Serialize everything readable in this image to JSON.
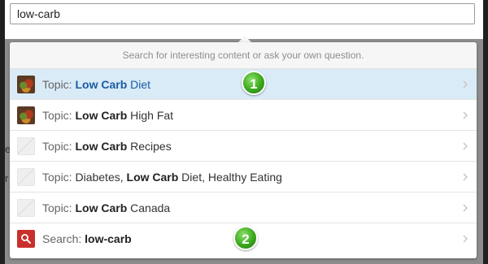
{
  "search": {
    "value": "low-carb"
  },
  "dropdown": {
    "hint": "Search for interesting content or ask your own question.",
    "items": [
      {
        "prefix": "Topic: ",
        "parts": [
          {
            "text": "Low Carb",
            "strong": true
          },
          {
            "text": " Diet",
            "strong": false
          }
        ],
        "thumb": "food-thumbnail",
        "selected": true
      },
      {
        "prefix": "Topic: ",
        "parts": [
          {
            "text": "Low Carb",
            "strong": true
          },
          {
            "text": " High Fat",
            "strong": false
          }
        ],
        "thumb": "food-thumbnail",
        "selected": false
      },
      {
        "prefix": "Topic: ",
        "parts": [
          {
            "text": "Low Carb",
            "strong": true
          },
          {
            "text": " Recipes",
            "strong": false
          }
        ],
        "thumb": "placeholder-thumbnail",
        "selected": false
      },
      {
        "prefix": "Topic: ",
        "parts": [
          {
            "text": "Diabetes, ",
            "strong": false
          },
          {
            "text": "Low Carb",
            "strong": true
          },
          {
            "text": " Diet, Healthy Eating",
            "strong": false
          }
        ],
        "thumb": "placeholder-thumbnail",
        "selected": false
      },
      {
        "prefix": "Topic: ",
        "parts": [
          {
            "text": "Low Carb",
            "strong": true
          },
          {
            "text": " Canada",
            "strong": false
          }
        ],
        "thumb": "placeholder-thumbnail",
        "selected": false
      },
      {
        "prefix": "Search: ",
        "parts": [
          {
            "text": "low-carb",
            "strong": true
          }
        ],
        "thumb": "search-icon",
        "selected": false
      }
    ]
  },
  "annotations": [
    {
      "label": "1"
    },
    {
      "label": "2"
    }
  ],
  "edge_text": {
    "left_1": "ec",
    "left_2": "r"
  },
  "colors": {
    "selected_row": "#d9ebf7",
    "selected_text": "#1a5da3",
    "badge_green": "#3aa81c",
    "search_icon_red": "#c9302c"
  }
}
